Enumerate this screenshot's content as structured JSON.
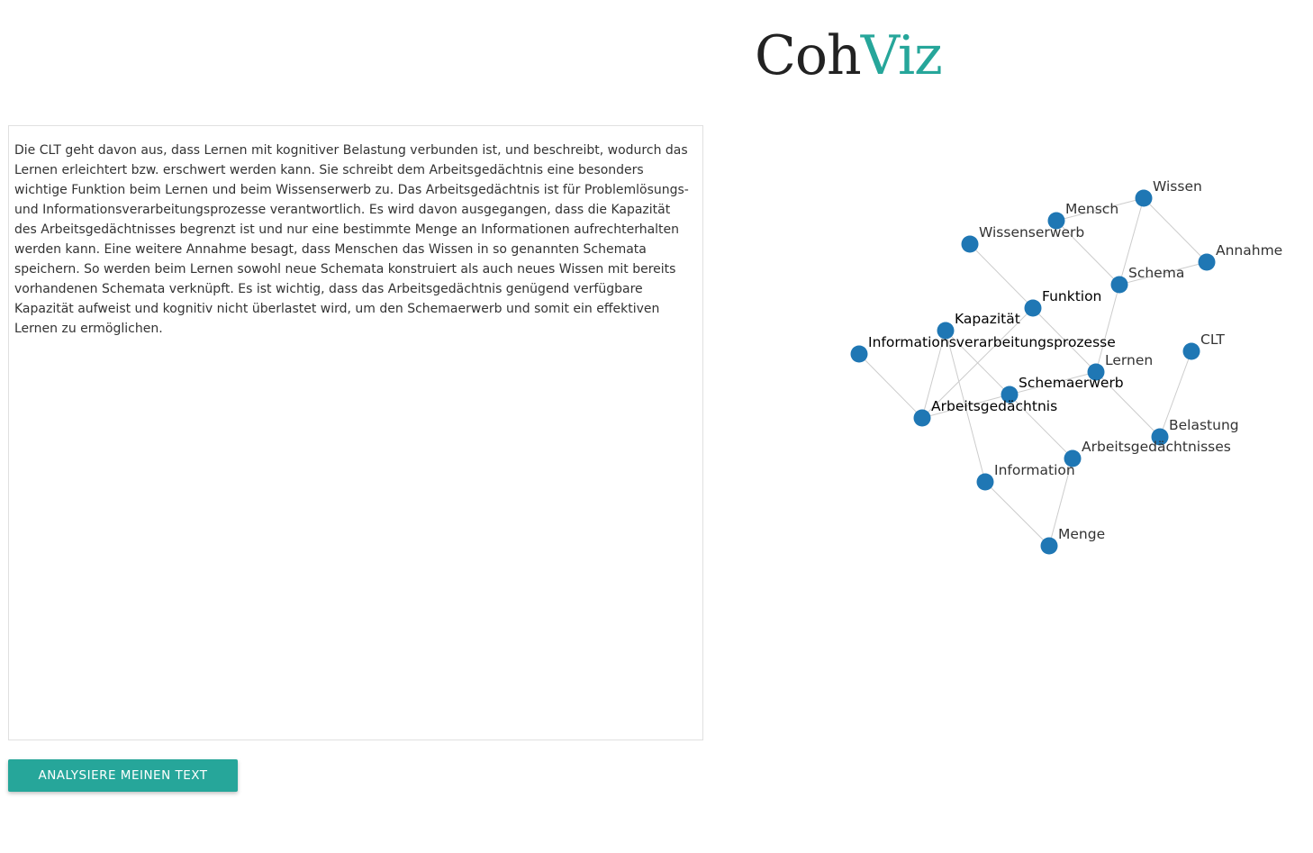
{
  "logo": {
    "part1": "Coh",
    "part2": "Viz",
    "accent_color": "#26a69a"
  },
  "text_input": {
    "value": "Die CLT geht davon aus, dass Lernen mit kognitiver Belastung verbunden ist, und beschreibt, wodurch das Lernen erleichtert bzw. erschwert werden kann. Sie schreibt dem Arbeitsgedächtnis eine besonders wichtige Funktion beim Lernen und beim Wissenserwerb zu. Das Arbeitsgedächtnis ist für Problemlösungs- und Informationsverarbeitungsprozesse verantwortlich. Es wird davon ausgegangen, dass die Kapazität des Arbeitsgedächtnisses begrenzt ist und nur eine bestimmte Menge an Informationen aufrechterhalten werden kann. Eine weitere Annahme besagt, dass Menschen das Wissen in so genannten Schemata speichern. So werden beim Lernen sowohl neue Schemata konstruiert als auch neues Wissen mit bereits vorhandenen Schemata verknüpft. Es ist wichtig, dass das Arbeitsgedächtnis genügend verfügbare Kapazität aufweist und kognitiv nicht überlastet wird, um den Schemaerwerb und somit ein effektiven Lernen zu ermöglichen."
  },
  "analyze_button": {
    "label": "Analysiere meinen Text",
    "color": "#26a69a"
  },
  "graph": {
    "node_color": "#1f77b4",
    "edge_color": "#cccccc",
    "nodes": [
      {
        "id": "Wissen",
        "label": "Wissen"
      },
      {
        "id": "Mensch",
        "label": "Mensch"
      },
      {
        "id": "Wissenserwerb",
        "label": "Wissenserwerb"
      },
      {
        "id": "Annahme",
        "label": "Annahme"
      },
      {
        "id": "Schema",
        "label": "Schema"
      },
      {
        "id": "Funktion",
        "label": "Funktion"
      },
      {
        "id": "Kapazitaet",
        "label": "Kapazität"
      },
      {
        "id": "Informationsverarbeitungsprozesse",
        "label": "Informationsverarbeitungsprozesse"
      },
      {
        "id": "CLT",
        "label": "CLT"
      },
      {
        "id": "Lernen",
        "label": "Lernen"
      },
      {
        "id": "Schemaerwerb",
        "label": "Schemaerwerb"
      },
      {
        "id": "Arbeitsgedaechtnis",
        "label": "Arbeitsgedächtnis"
      },
      {
        "id": "Belastung",
        "label": "Belastung"
      },
      {
        "id": "Arbeitsgedaechtnisses",
        "label": "Arbeitsgedächtnisses"
      },
      {
        "id": "Information",
        "label": "Information"
      },
      {
        "id": "Menge",
        "label": "Menge"
      }
    ],
    "edges": [
      [
        "Mensch",
        "Wissen"
      ],
      [
        "Wissen",
        "Annahme"
      ],
      [
        "Wissen",
        "Schema"
      ],
      [
        "Mensch",
        "Schema"
      ],
      [
        "Schema",
        "Annahme"
      ],
      [
        "Wissenserwerb",
        "Funktion"
      ],
      [
        "Funktion",
        "Lernen"
      ],
      [
        "Schema",
        "Lernen"
      ],
      [
        "Funktion",
        "Arbeitsgedaechtnis"
      ],
      [
        "Kapazitaet",
        "Arbeitsgedaechtnis"
      ],
      [
        "Kapazitaet",
        "Arbeitsgedaechtnisses"
      ],
      [
        "Kapazitaet",
        "Information"
      ],
      [
        "Informationsverarbeitungsprozesse",
        "Arbeitsgedaechtnis"
      ],
      [
        "Arbeitsgedaechtnis",
        "Schemaerwerb"
      ],
      [
        "Schemaerwerb",
        "Lernen"
      ],
      [
        "Lernen",
        "Belastung"
      ],
      [
        "CLT",
        "Belastung"
      ],
      [
        "Information",
        "Menge"
      ],
      [
        "Arbeitsgedaechtnisses",
        "Menge"
      ]
    ]
  }
}
